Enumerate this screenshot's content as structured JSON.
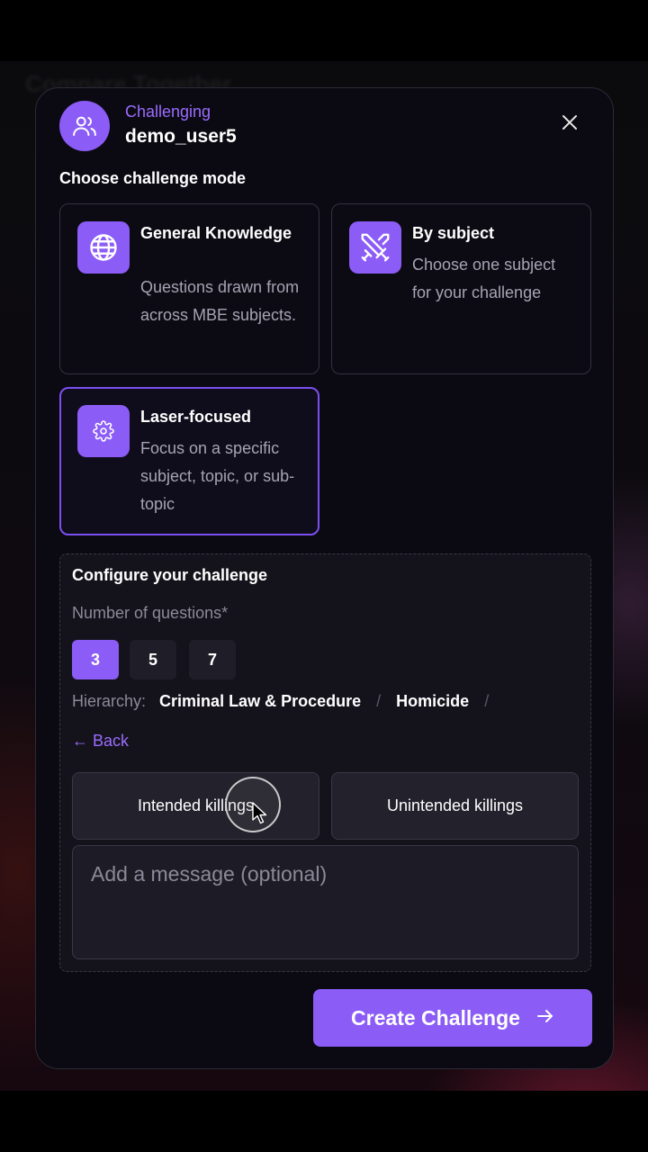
{
  "background": {
    "title": "Compare Together"
  },
  "header": {
    "label": "Challenging",
    "username": "demo_user5",
    "avatar_icon": "users-icon",
    "close_icon": "close-icon"
  },
  "modes": {
    "title": "Choose challenge mode",
    "items": [
      {
        "title": "General Knowledge",
        "description": "Questions drawn from across MBE subjects.",
        "icon": "globe-icon",
        "selected": false
      },
      {
        "title": "By subject",
        "description": "Choose one subject for your challenge",
        "icon": "swords-icon",
        "selected": false
      },
      {
        "title": "Laser-focused",
        "description": "Focus on a specific subject, topic, or sub-topic",
        "icon": "gear-icon",
        "selected": true
      }
    ]
  },
  "config": {
    "title": "Configure your challenge",
    "num_label": "Number of questions*",
    "num_options": [
      "3",
      "5",
      "7"
    ],
    "num_selected": "3",
    "hierarchy_label": "Hierarchy:",
    "hierarchy": [
      "Criminal Law & Procedure",
      "Homicide"
    ],
    "separator": "/",
    "back_label": "← Back",
    "subtopics": [
      "Intended killings",
      "Unintended killings"
    ],
    "message_placeholder": "Add a message (optional)"
  },
  "actions": {
    "create_label": "Create Challenge",
    "create_icon": "arrow-right-icon"
  },
  "colors": {
    "accent": "#8b5cf6",
    "accent_text": "#9b6cff",
    "modal_bg": "#0b0a12",
    "panel_bg": "#14131b"
  }
}
